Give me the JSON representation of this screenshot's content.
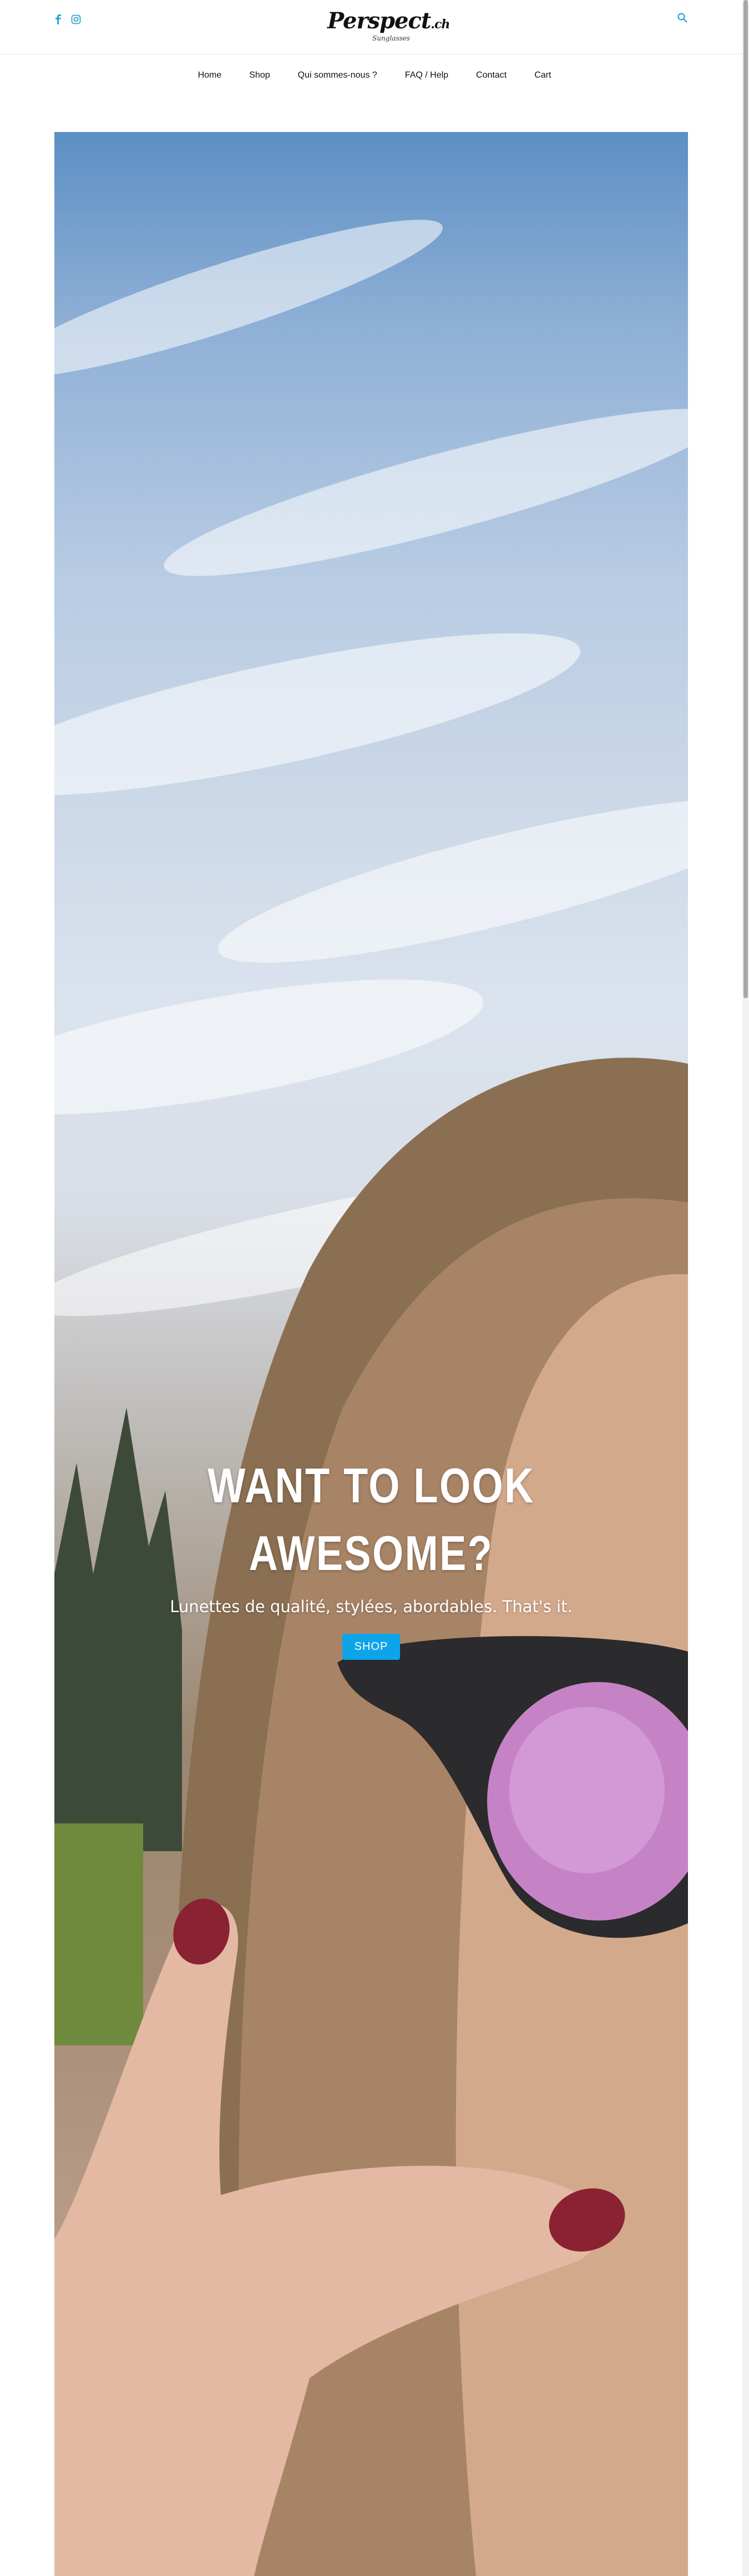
{
  "header": {
    "social": [
      {
        "name": "facebook-icon",
        "glyph": "f"
      },
      {
        "name": "instagram-icon",
        "glyph": "◎"
      }
    ],
    "logo": {
      "main": "Perspect",
      "tld": ".ch",
      "tagline": "Sunglasses"
    },
    "search_icon": "search-icon",
    "accent_color": "#2aa7cf"
  },
  "nav": {
    "items": [
      {
        "label": "Home"
      },
      {
        "label": "Shop"
      },
      {
        "label": "Qui sommes-nous ?"
      },
      {
        "label": "FAQ / Help"
      },
      {
        "label": "Contact"
      },
      {
        "label": "Cart"
      }
    ]
  },
  "hero": {
    "title_line1": "WANT TO LOOK",
    "title_line2": "AWESOME?",
    "subtitle": "Lunettes de qualité, stylées, abordables. That's it.",
    "button_label": "SHOP",
    "button_color": "#0ea4e9"
  }
}
